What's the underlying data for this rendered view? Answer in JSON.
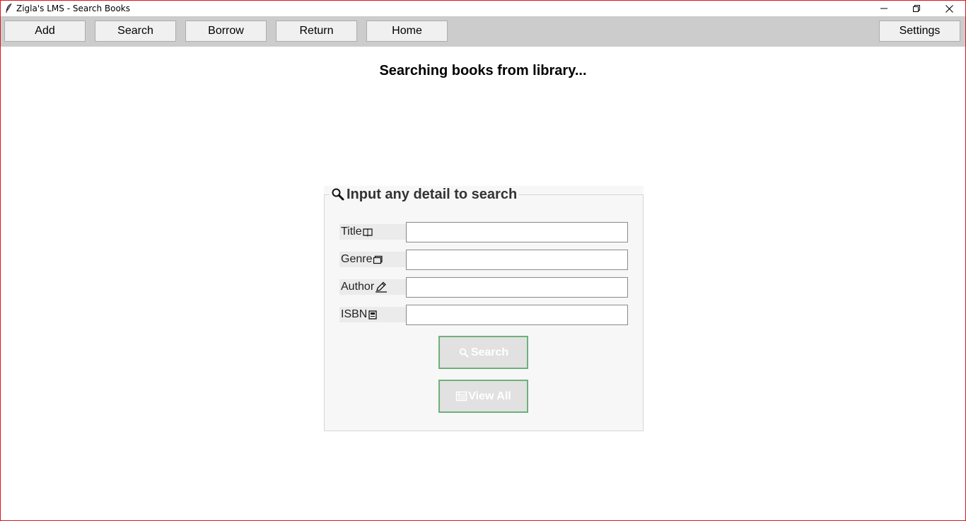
{
  "window": {
    "title": "Zigla's LMS - Search Books",
    "border_color": "#d9161c"
  },
  "toolbar": {
    "background": "#cccccc",
    "left_buttons": [
      {
        "label": "Add"
      },
      {
        "label": "Search"
      },
      {
        "label": "Borrow"
      },
      {
        "label": "Return"
      },
      {
        "label": "Home"
      }
    ],
    "settings_label": "Settings"
  },
  "main": {
    "heading": "Searching books from library..."
  },
  "search_panel": {
    "legend": "Input any detail to search",
    "legend_icon": "magnifier-icon",
    "fields": [
      {
        "label": "Title",
        "icon": "book-icon",
        "value": ""
      },
      {
        "label": "Genre",
        "icon": "folder-icon",
        "value": ""
      },
      {
        "label": "Author",
        "icon": "pencil-icon",
        "value": ""
      },
      {
        "label": "ISBN",
        "icon": "barcode-icon",
        "value": ""
      }
    ],
    "search_button": {
      "label": "Search",
      "icon": "search-icon"
    },
    "view_all_button": {
      "label": "View All",
      "icon": "list-icon"
    },
    "button_border_color": "#6fb07a"
  }
}
